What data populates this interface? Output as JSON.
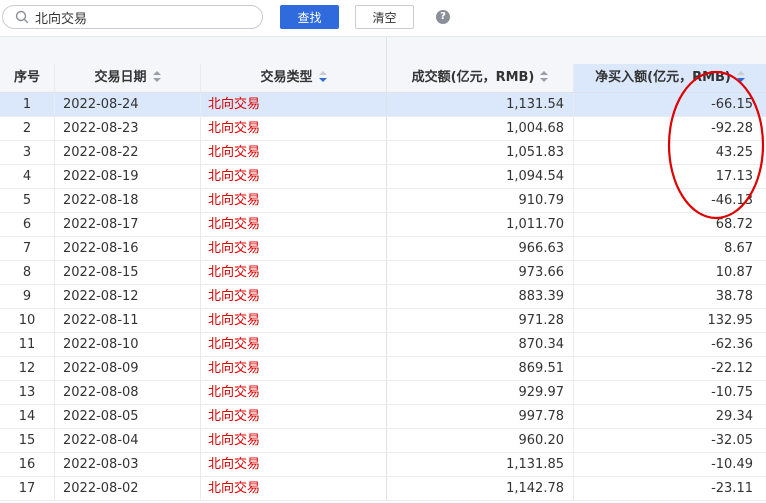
{
  "search": {
    "value": "北向交易",
    "placeholder": ""
  },
  "toolbar": {
    "search_label": "查找",
    "clear_label": "清空",
    "help_label": "?"
  },
  "accent": "#2f6bdc",
  "type_color": "#e00000",
  "annotation_color": "#e00000",
  "table": {
    "headers": [
      "序号",
      "交易日期",
      "交易类型",
      "成交额(亿元，RMB)",
      "净买入额(亿元，RMB)"
    ],
    "sorted_column": "交易类型",
    "rows": [
      [
        "1",
        "2022-08-24",
        "北向交易",
        "1,131.54",
        "-66.15"
      ],
      [
        "2",
        "2022-08-23",
        "北向交易",
        "1,004.68",
        "-92.28"
      ],
      [
        "3",
        "2022-08-22",
        "北向交易",
        "1,051.83",
        "43.25"
      ],
      [
        "4",
        "2022-08-19",
        "北向交易",
        "1,094.54",
        "17.13"
      ],
      [
        "5",
        "2022-08-18",
        "北向交易",
        "910.79",
        "-46.13"
      ],
      [
        "6",
        "2022-08-17",
        "北向交易",
        "1,011.70",
        "68.72"
      ],
      [
        "7",
        "2022-08-16",
        "北向交易",
        "966.63",
        "8.67"
      ],
      [
        "8",
        "2022-08-15",
        "北向交易",
        "973.66",
        "10.87"
      ],
      [
        "9",
        "2022-08-12",
        "北向交易",
        "883.39",
        "38.78"
      ],
      [
        "10",
        "2022-08-11",
        "北向交易",
        "971.28",
        "132.95"
      ],
      [
        "11",
        "2022-08-10",
        "北向交易",
        "870.34",
        "-62.36"
      ],
      [
        "12",
        "2022-08-09",
        "北向交易",
        "869.51",
        "-22.12"
      ],
      [
        "13",
        "2022-08-08",
        "北向交易",
        "929.97",
        "-10.75"
      ],
      [
        "14",
        "2022-08-05",
        "北向交易",
        "997.78",
        "29.34"
      ],
      [
        "15",
        "2022-08-04",
        "北向交易",
        "960.20",
        "-32.05"
      ],
      [
        "16",
        "2022-08-03",
        "北向交易",
        "1,131.85",
        "-10.49"
      ],
      [
        "17",
        "2022-08-02",
        "北向交易",
        "1,142.78",
        "-23.11"
      ]
    ]
  }
}
